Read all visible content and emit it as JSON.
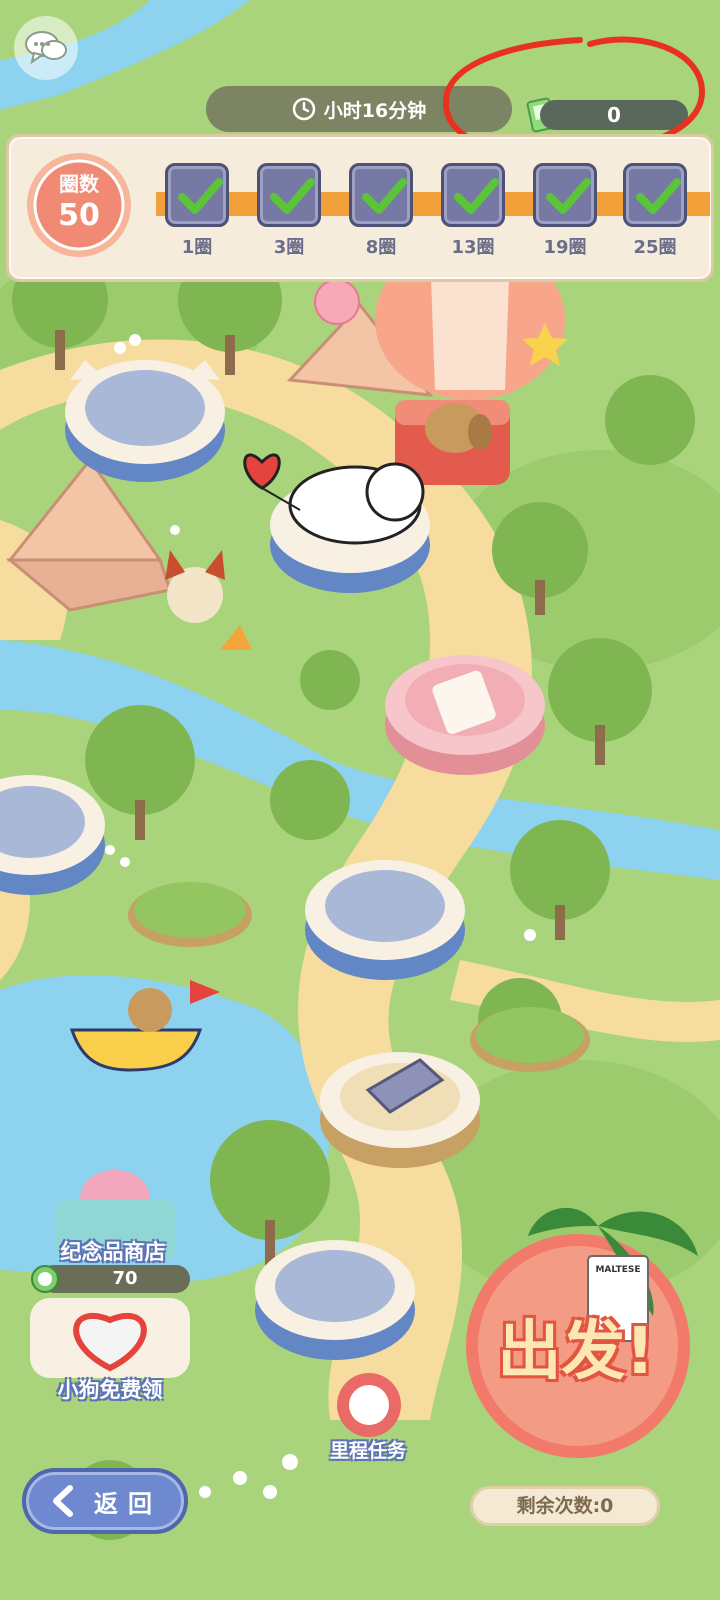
{
  "hud": {
    "timer_text": "小时16分钟",
    "ticket_count": "0"
  },
  "rounds_panel": {
    "label": "圈数",
    "value": "50",
    "rewards": [
      {
        "label": "1圈",
        "claimed": true
      },
      {
        "label": "3圈",
        "claimed": true
      },
      {
        "label": "8圈",
        "claimed": true
      },
      {
        "label": "13圈",
        "claimed": true
      },
      {
        "label": "19圈",
        "claimed": true
      },
      {
        "label": "25圈",
        "claimed": true
      }
    ]
  },
  "shop": {
    "label": "纪念品商店",
    "coin_count": "70"
  },
  "free_dog": {
    "label": "小狗免费领"
  },
  "milestone": {
    "label": "里程任务"
  },
  "back": {
    "label": "返回"
  },
  "go_button": {
    "label": "出发!",
    "remaining": "剩余次数:0",
    "ticket_text": "MALTESE"
  },
  "colors": {
    "grass": "#a9d47b",
    "river": "#8dd2ef",
    "path": "#f7dca0",
    "accent_orange": "#f2a03a",
    "check_green": "#5cc43a",
    "annotation_red": "#e8321f"
  }
}
